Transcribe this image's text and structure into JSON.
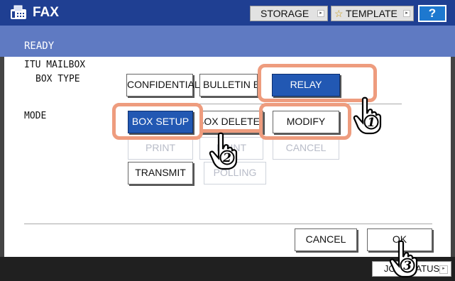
{
  "header": {
    "title": "FAX",
    "storage_label": "STORAGE",
    "template_label": "TEMPLATE",
    "help_label": "?"
  },
  "status_text": "READY",
  "section_title": "ITU MAILBOX",
  "box_type": {
    "label": "BOX TYPE",
    "options": [
      "CONFIDENTIAL",
      "BULLETIN BD",
      "RELAY"
    ],
    "selected": "RELAY"
  },
  "mode": {
    "label": "MODE",
    "buttons": [
      "BOX SETUP",
      "BOX DELETE",
      "MODIFY",
      "PRINT",
      "PRINT",
      "CANCEL",
      "TRANSMIT",
      "POLLING"
    ],
    "selected": "BOX SETUP"
  },
  "actions": {
    "cancel_label": "CANCEL",
    "ok_label": "OK"
  },
  "footer": {
    "job_status_label": "JOB STATUS"
  },
  "steps": [
    "1",
    "2",
    "3"
  ],
  "colors": {
    "titlebar": "#1f3f92",
    "subbar": "#5f7ac2",
    "selected_button": "#2258b3",
    "callout": "#ee9c7e"
  }
}
